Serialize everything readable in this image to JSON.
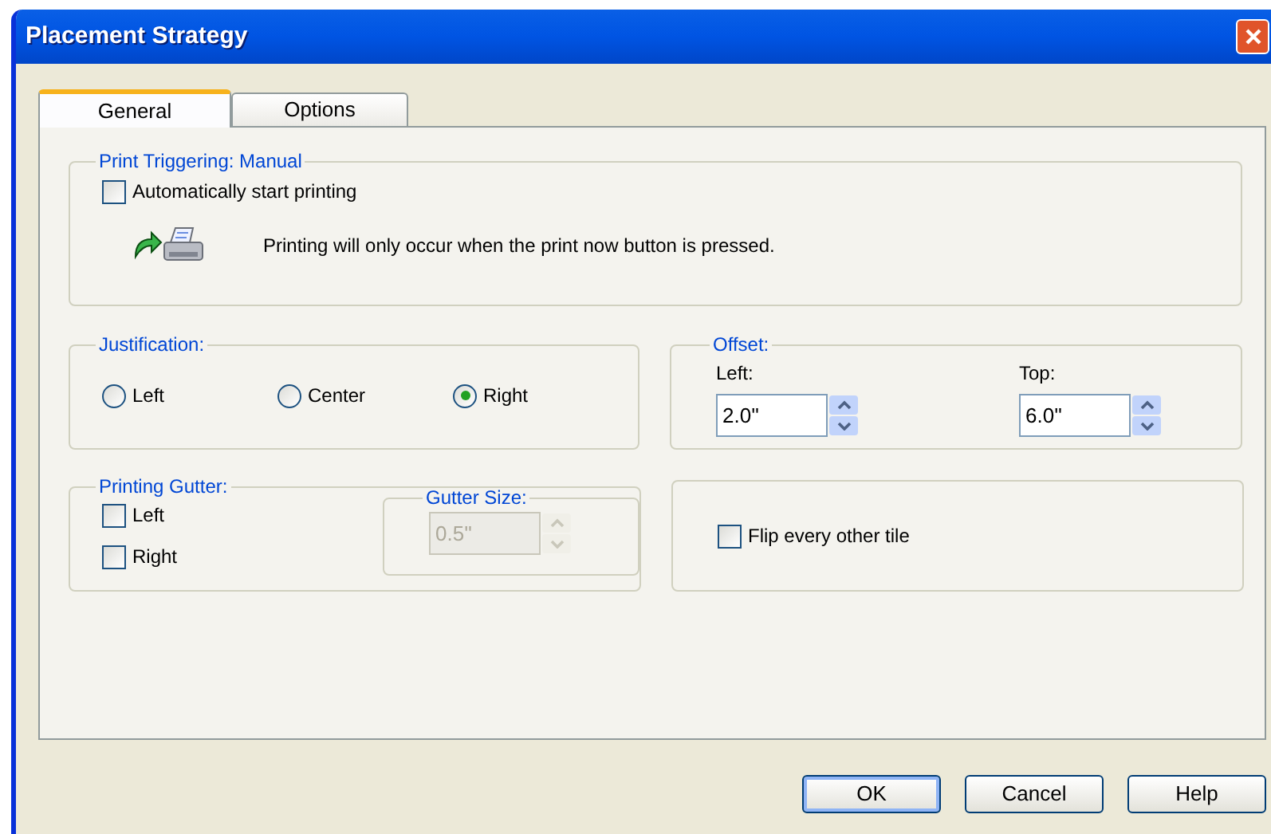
{
  "window": {
    "title": "Placement Strategy"
  },
  "tabs": [
    {
      "label": "General",
      "selected": true
    },
    {
      "label": "Options",
      "selected": false
    }
  ],
  "print_triggering": {
    "title": "Print Triggering: Manual",
    "auto_start": {
      "label": "Automatically start printing",
      "checked": false
    },
    "info": "Printing will only occur when the print now button is pressed."
  },
  "justification": {
    "title": "Justification:",
    "options": [
      {
        "label": "Left",
        "selected": false
      },
      {
        "label": "Center",
        "selected": false
      },
      {
        "label": "Right",
        "selected": true
      }
    ]
  },
  "offset": {
    "title": "Offset:",
    "fields": [
      {
        "label": "Left:",
        "value": "2.0''"
      },
      {
        "label": "Top:",
        "value": "6.0''"
      }
    ]
  },
  "printing_gutter": {
    "title": "Printing Gutter:",
    "checkboxes": [
      {
        "label": "Left",
        "checked": false
      },
      {
        "label": "Right",
        "checked": false
      }
    ],
    "gutter_size": {
      "title": "Gutter Size:",
      "value": "0.5''",
      "disabled": true
    }
  },
  "flip": {
    "label": "Flip every other tile",
    "checked": false
  },
  "buttons": [
    {
      "label": "OK",
      "default": true
    },
    {
      "label": "Cancel",
      "default": false
    },
    {
      "label": "Help",
      "default": false
    }
  ]
}
